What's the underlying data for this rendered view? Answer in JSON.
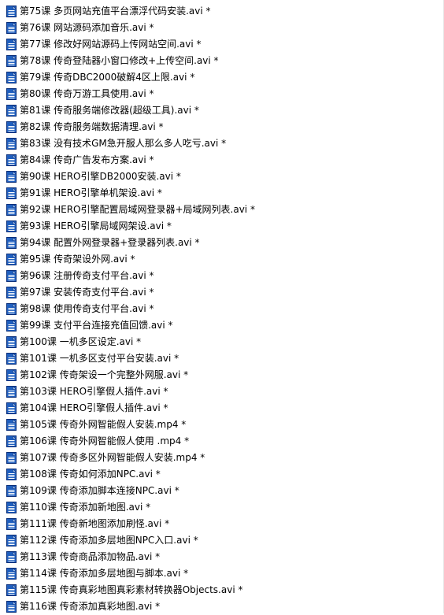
{
  "files": [
    {
      "name": "第75课 多页网站充值平台漂浮代码安装.avi *"
    },
    {
      "name": "第76课 网站源码添加音乐.avi *"
    },
    {
      "name": "第77课 修改好网站源码上传网站空间.avi *"
    },
    {
      "name": "第78课 传奇登陆器小窗口修改+上传空间.avi *"
    },
    {
      "name": "第79课 传奇DBC2000破解4区上限.avi *"
    },
    {
      "name": "第80课 传奇万游工具使用.avi *"
    },
    {
      "name": "第81课 传奇服务端修改器(超级工具).avi *"
    },
    {
      "name": "第82课 传奇服务端数据清理.avi *"
    },
    {
      "name": "第83课 没有技术GM急开服人那么多人吃亏.avi *"
    },
    {
      "name": "第84课 传奇广告发布方案.avi *"
    },
    {
      "name": "第90课 HERO引擎DB2000安装.avi *"
    },
    {
      "name": "第91课 HERO引擎单机架设.avi *"
    },
    {
      "name": "第92课 HERO引擎配置局域网登录器+局域网列表.avi *"
    },
    {
      "name": "第93课 HERO引擎局域网架设.avi *"
    },
    {
      "name": "第94课 配置外网登录器+登录器列表.avi *"
    },
    {
      "name": "第95课 传奇架设外网.avi *"
    },
    {
      "name": "第96课 注册传奇支付平台.avi *"
    },
    {
      "name": "第97课  安装传奇支付平台.avi *"
    },
    {
      "name": "第98课 使用传奇支付平台.avi *"
    },
    {
      "name": "第99课 支付平台连接充值回馈.avi *"
    },
    {
      "name": "第100课 一机多区设定.avi *"
    },
    {
      "name": "第101课 一机多区支付平台安装.avi *"
    },
    {
      "name": "第102课 传奇架设一个完整外网服.avi *"
    },
    {
      "name": "第103课 HERO引擎假人插件.avi *"
    },
    {
      "name": "第104课 HERO引擎假人插件.avi *"
    },
    {
      "name": "第105课 传奇外网智能假人安装.mp4 *"
    },
    {
      "name": "第106课 传奇外网智能假人使用 .mp4 *"
    },
    {
      "name": "第107课 传奇多区外网智能假人安装.mp4 *"
    },
    {
      "name": "第108课 传奇如何添加NPC.avi *"
    },
    {
      "name": "第109课 传奇添加脚本连接NPC.avi *"
    },
    {
      "name": "第110课 传奇添加新地图.avi *"
    },
    {
      "name": "第111课 传奇新地图添加刷怪.avi *"
    },
    {
      "name": "第112课 传奇添加多层地图NPC入口.avi *"
    },
    {
      "name": "第113课 传奇商品添加物品.avi *"
    },
    {
      "name": "第114课 传奇添加多层地图与脚本.avi *"
    },
    {
      "name": "第115课 传奇真彩地图真彩素材转换器Objects.avi *"
    },
    {
      "name": "第116课 传奇添加真彩地图.avi *"
    }
  ],
  "icon_colors": {
    "doc_fill": "#1f5fbf",
    "doc_border": "#0b2f7a",
    "doc_lines": "#ffffff"
  }
}
